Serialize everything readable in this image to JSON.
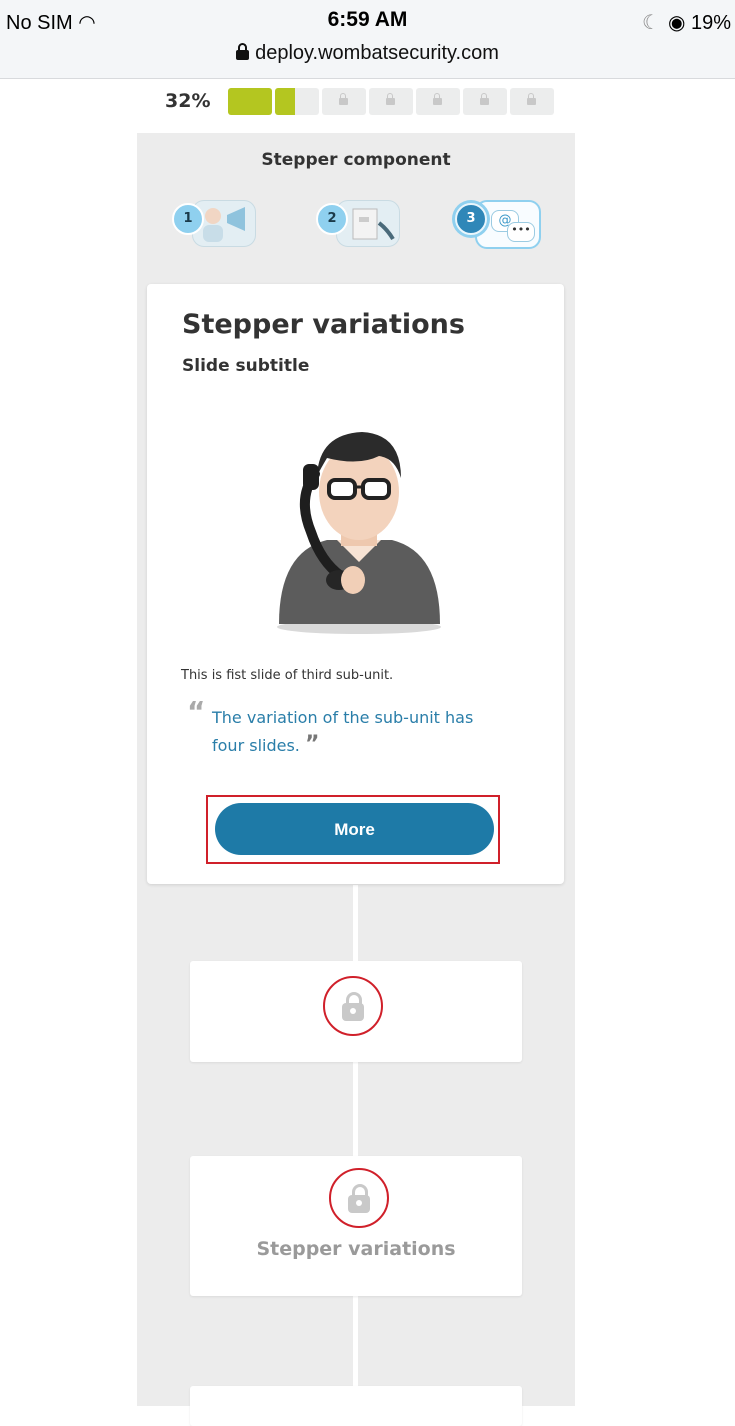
{
  "status_bar": {
    "carrier": "No SIM",
    "wifi_icon": "wifi-icon",
    "time": "6:59 AM",
    "battery": "19%",
    "url": "deploy.wombatsecurity.com"
  },
  "progress": {
    "percent_label": "32%",
    "value": 0.32,
    "segments": [
      "complete",
      "partial",
      "locked",
      "locked",
      "locked",
      "locked",
      "locked"
    ]
  },
  "component": {
    "title": "Stepper component",
    "steps": [
      {
        "number": "1",
        "state": "visited",
        "icon": "megaphone-person-icon"
      },
      {
        "number": "2",
        "state": "visited",
        "icon": "phone-document-icon"
      },
      {
        "number": "3",
        "state": "active",
        "icon": "email-chat-icon"
      }
    ]
  },
  "active_card": {
    "title": "Stepper variations",
    "subtitle": "Slide subtitle",
    "image": "man-on-phone-illustration",
    "body": "This is fist slide of third sub-unit.",
    "quote": "The variation of the sub-unit has four slides.",
    "button_label": "More"
  },
  "locked_cards": [
    {
      "title": "",
      "icon": "lock-icon"
    },
    {
      "title": "Stepper variations",
      "icon": "lock-icon"
    },
    {
      "title": "",
      "icon": "lock-icon"
    }
  ],
  "colors": {
    "accent_blue": "#1e7aa7",
    "progress_green": "#b4c620",
    "highlight_red": "#d0202a",
    "quote_blue": "#2a7ea9"
  }
}
